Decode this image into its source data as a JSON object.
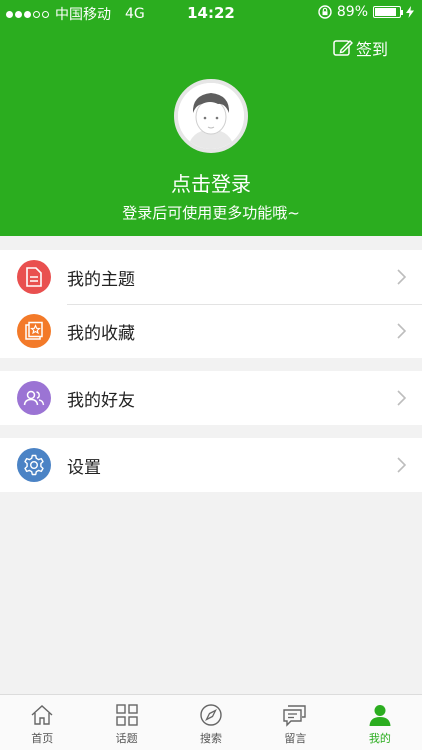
{
  "status": {
    "carrier": "中国移动",
    "network": "4G",
    "time": "14:22",
    "battery": "89%",
    "battery_level": 89
  },
  "header": {
    "signin_label": "签到",
    "login_title": "点击登录",
    "login_subtitle": "登录后可使用更多功能哦~",
    "bg_color": "#2bad1f"
  },
  "menu": {
    "group1": [
      {
        "label": "我的主题",
        "icon": "document-icon",
        "color": "#e9504f"
      },
      {
        "label": "我的收藏",
        "icon": "star-icon",
        "color": "#f37a29"
      }
    ],
    "group2": [
      {
        "label": "我的好友",
        "icon": "friends-icon",
        "color": "#9b74d4"
      }
    ],
    "group3": [
      {
        "label": "设置",
        "icon": "gear-icon",
        "color": "#4b83c5"
      }
    ]
  },
  "tabs": [
    {
      "label": "首页",
      "icon": "home-icon",
      "active": false
    },
    {
      "label": "话题",
      "icon": "grid-icon",
      "active": false
    },
    {
      "label": "搜索",
      "icon": "compass-icon",
      "active": false
    },
    {
      "label": "留言",
      "icon": "message-icon",
      "active": false
    },
    {
      "label": "我的",
      "icon": "person-icon",
      "active": true
    }
  ]
}
